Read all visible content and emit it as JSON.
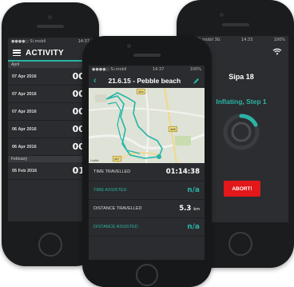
{
  "left_phone": {
    "status": {
      "carrier": "●●●●○ Si.mobil",
      "time": "14:37"
    },
    "title": "ACTIVITY",
    "groups": [
      {
        "month": "April",
        "rows": [
          {
            "date": "07 Apr 2016",
            "time": "00:0"
          },
          {
            "date": "07 Apr 2016",
            "time": "00:0"
          },
          {
            "date": "07 Apr 2016",
            "time": "00:0"
          },
          {
            "date": "06 Apr 2016",
            "time": "00:0"
          },
          {
            "date": "06 Apr 2016",
            "time": "00:0"
          }
        ]
      },
      {
        "month": "February",
        "rows": [
          {
            "date": "05 Feb 2016",
            "time": "01:1"
          }
        ]
      }
    ]
  },
  "center_phone": {
    "status": {
      "carrier": "●●●●○ Si.mobil",
      "time": "14:37",
      "battery": "100%"
    },
    "title": "21.6.15 - Pebble beach",
    "map": {
      "road_labels": [
        "444",
        "447",
        "448"
      ],
      "credit": "Leaflet"
    },
    "stats": [
      {
        "label": "TIME TRAVELLED",
        "value": "01:14:38",
        "unit": "",
        "accent": false
      },
      {
        "label": "TIME ASSISTED",
        "value": "n/a",
        "unit": "",
        "accent": true
      },
      {
        "label": "DISTANCE TRAVELLED",
        "value": "5.3",
        "unit": "km",
        "accent": false
      },
      {
        "label": "DISTANCE ASSISTED",
        "value": "n/a",
        "unit": "",
        "accent": true
      }
    ]
  },
  "right_phone": {
    "status": {
      "carrier": "Si.mobil  3G",
      "time": "14:33",
      "battery": "100%"
    },
    "device": "Sipa 18",
    "state": "Inflating, Step 1",
    "abort_label": "ABORT!"
  },
  "colors": {
    "accent": "#2bb3a5",
    "danger": "#e2181b",
    "screen": "#2a2c2f"
  }
}
